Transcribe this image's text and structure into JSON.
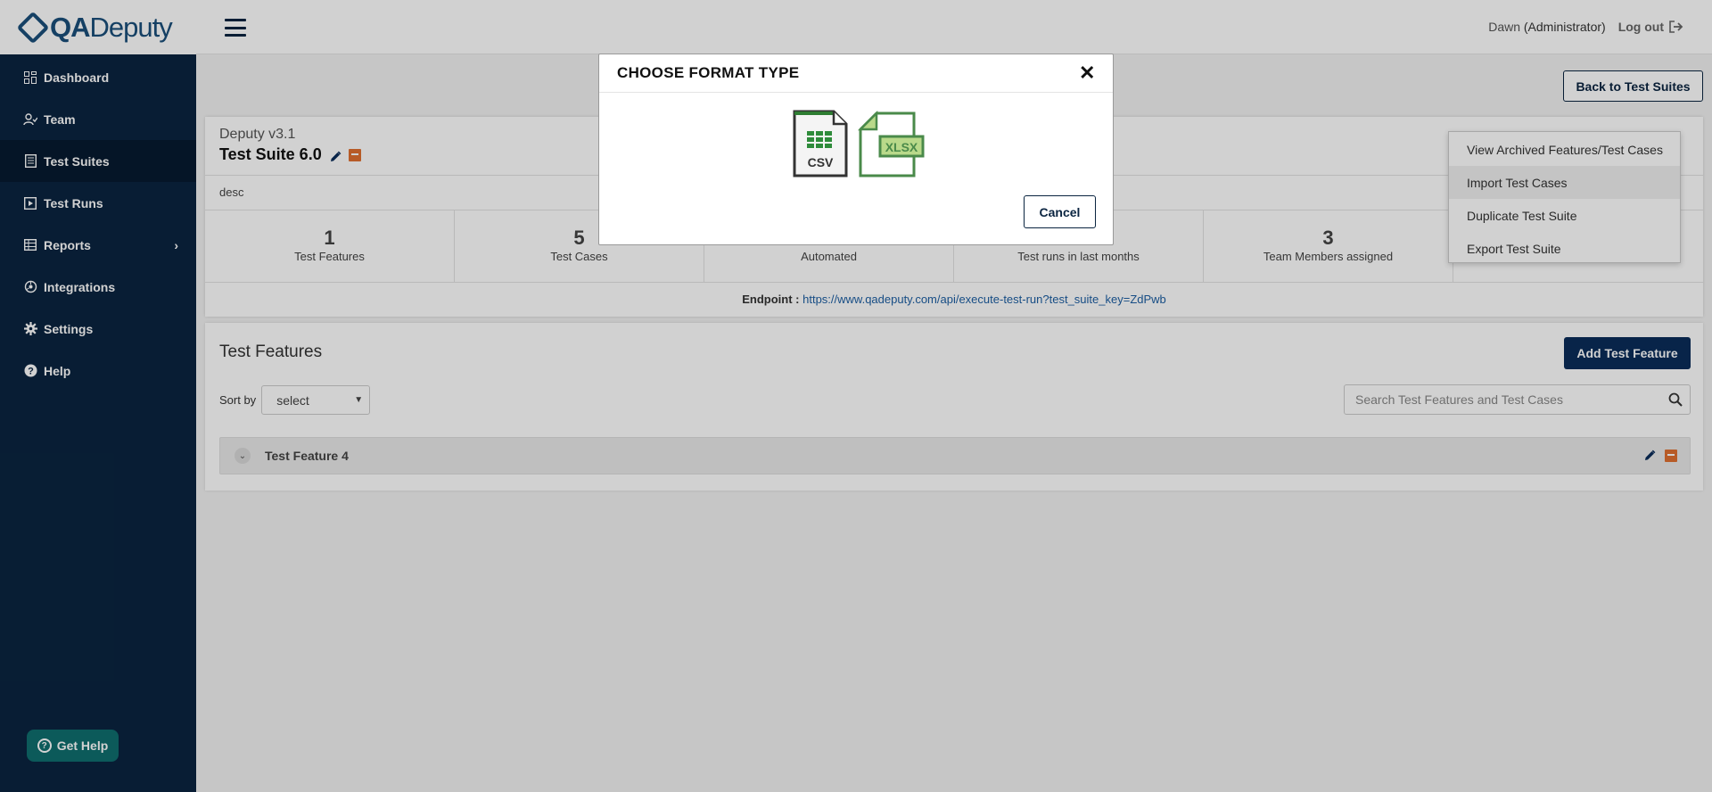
{
  "app": {
    "logo_qa": "QA",
    "logo_deputy": "Deputy"
  },
  "sidebar": {
    "items": [
      {
        "label": "Dashboard",
        "icon": "dashboard-icon"
      },
      {
        "label": "Team",
        "icon": "team-icon"
      },
      {
        "label": "Test Suites",
        "icon": "test-suites-icon"
      },
      {
        "label": "Test Runs",
        "icon": "test-runs-icon"
      },
      {
        "label": "Reports",
        "icon": "reports-icon"
      },
      {
        "label": "Integrations",
        "icon": "integrations-icon"
      },
      {
        "label": "Settings",
        "icon": "gear-icon"
      },
      {
        "label": "Help",
        "icon": "help-icon"
      }
    ],
    "active": "Test Suites",
    "get_help": "Get Help"
  },
  "header": {
    "user_name": "Dawn",
    "user_role": "(Administrator)",
    "logout": "Log out"
  },
  "suite": {
    "back_button": "Back to Test Suites",
    "project": "Deputy v3.1",
    "title": "Test Suite 6.0",
    "description": "desc",
    "stats": [
      {
        "value": "1",
        "label": "Test Features"
      },
      {
        "value": "5",
        "label": "Test Cases"
      },
      {
        "value": "",
        "label": "Automated"
      },
      {
        "value": "",
        "label": "Test runs in last months"
      },
      {
        "value": "3",
        "label": "Team Members assigned"
      },
      {
        "value": "",
        "label": ""
      }
    ],
    "endpoint_label": "Endpoint :",
    "endpoint_url": "https://www.qadeputy.com/api/execute-test-run?test_suite_key=ZdPwb"
  },
  "actions_menu": {
    "items": [
      "View Archived Features/Test Cases",
      "Import Test Cases",
      "Duplicate Test Suite",
      "Export Test Suite"
    ],
    "hovered": "Import Test Cases"
  },
  "features": {
    "title": "Test Features",
    "add_button": "Add Test Feature",
    "sort_label": "Sort by",
    "sort_value": "select",
    "search_placeholder": "Search Test Features and Test Cases",
    "rows": [
      {
        "name": "Test Feature 4"
      }
    ]
  },
  "modal": {
    "title": "CHOOSE FORMAT TYPE",
    "formats": [
      {
        "label": "CSV",
        "icon": "csv-file-icon"
      },
      {
        "label": "XLSX",
        "icon": "xlsx-file-icon"
      }
    ],
    "cancel": "Cancel"
  },
  "colors": {
    "sidebar_bg": "#0a2440",
    "primary_button": "#0a2d5a",
    "link": "#1d5fa3",
    "delete_orange": "#e07030",
    "help_button": "#0f6e6e"
  }
}
